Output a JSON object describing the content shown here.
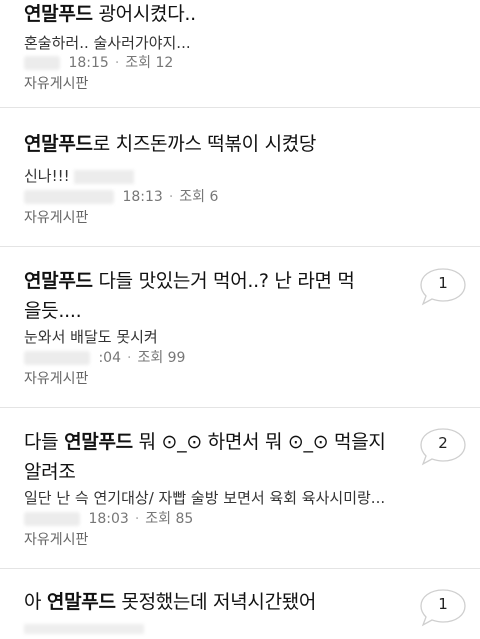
{
  "posts": [
    {
      "title_bold": "연말푸드",
      "title_rest": " 광어시켰다..",
      "title_line2": "",
      "preview": "혼술하러.. 술사러가야지...",
      "time": "18:15",
      "views": "조회 12",
      "board": "자유게시판",
      "comments": ""
    },
    {
      "title_bold": "연말푸드",
      "title_rest": "로 치즈돈까스 떡볶이 시켰당",
      "title_line2": "",
      "preview": "신나!!!",
      "time": "18:13",
      "views": "조회 6",
      "board": "자유게시판",
      "comments": ""
    },
    {
      "title_bold": "연말푸드",
      "title_rest": " 다들 맛있는거 먹어..? 난 라면 먹",
      "title_line2": "을듯....",
      "preview": "눈와서 배달도 못시켜",
      "time": ":04",
      "views": "조회 99",
      "board": "자유게시판",
      "comments": "1"
    },
    {
      "title_pre": "다들 ",
      "title_bold": "연말푸드",
      "title_rest": " 뭐 ⊙_⊙ 하면서 뭐 ⊙_⊙ 먹을지",
      "title_line2": "알려조",
      "preview": "일단 난 슥 연기대상/ 자빱 술방 보면서 육회 육사시미랑...",
      "time": "18:03",
      "views": "조회 85",
      "board": "자유게시판",
      "comments": "2"
    },
    {
      "title_pre": "아 ",
      "title_bold": "연말푸드",
      "title_rest": " 못정했는데 저녁시간됐어",
      "comments": "1"
    }
  ]
}
